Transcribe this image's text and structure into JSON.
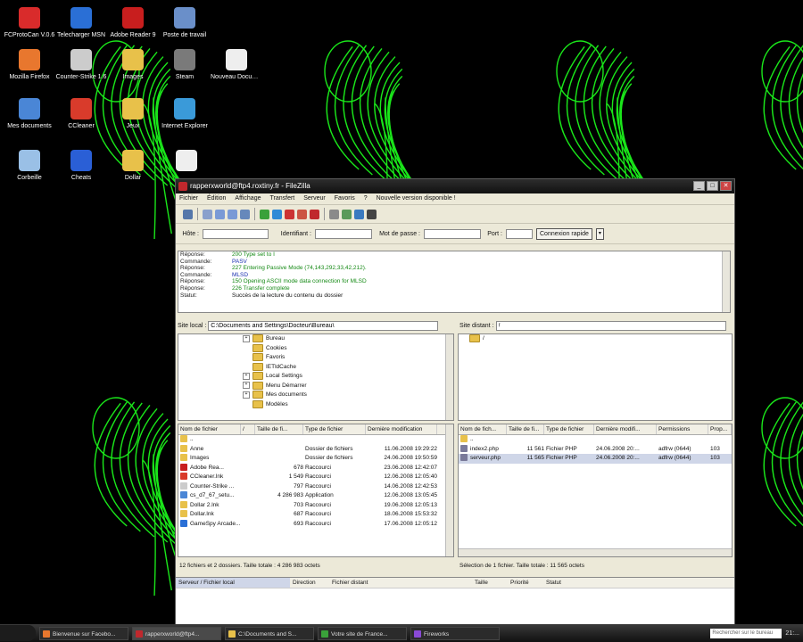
{
  "desktop": {
    "icons": [
      {
        "label": "FCProtoCan V.0.6",
        "color": "#d92b2b",
        "icon": "app-icon"
      },
      {
        "label": "Telecharger MSN",
        "color": "#2a6fd6",
        "icon": "messenger-icon"
      },
      {
        "label": "Adobe Reader 9",
        "color": "#c81e1e",
        "icon": "pdf-reader-icon"
      },
      {
        "label": "Poste de travail",
        "color": "#6a8fc9",
        "icon": "computer-icon"
      },
      {
        "label": "Mozilla Firefox",
        "color": "#e8772e",
        "icon": "firefox-icon"
      },
      {
        "label": "Counter-Strike 1.6",
        "color": "#cccccc",
        "icon": "game-icon"
      },
      {
        "label": "Images",
        "color": "#e8c14a",
        "icon": "folder-icon"
      },
      {
        "label": "Steam",
        "color": "#7a7a7a",
        "icon": "steam-icon"
      },
      {
        "label": "Nouveau Document texte",
        "color": "#eeeeee",
        "icon": "text-file-icon"
      },
      {
        "label": "Mes documents",
        "color": "#4a86d6",
        "icon": "documents-icon"
      },
      {
        "label": "CCleaner",
        "color": "#d93b2b",
        "icon": "ccleaner-icon"
      },
      {
        "label": "Jeux",
        "color": "#e8c14a",
        "icon": "folder-icon"
      },
      {
        "label": "Internet Explorer",
        "color": "#3a9ad9",
        "icon": "ie-icon"
      },
      {
        "label": "Corbeille",
        "color": "#9ac0e6",
        "icon": "recycle-bin-icon"
      },
      {
        "label": "Cheats",
        "color": "#2a5fd6",
        "icon": "cheats-icon"
      },
      {
        "label": "Dollar",
        "color": "#e8c14a",
        "icon": "dollar-icon"
      },
      {
        "label": "",
        "color": "#eeeeee",
        "icon": "document-icon"
      }
    ]
  },
  "window": {
    "title": "rapperxworld@ftp4.roxtiny.fr - FileZilla",
    "min": "_",
    "max": "□",
    "close": "✕",
    "menu": [
      "Fichier",
      "Édition",
      "Affichage",
      "Transfert",
      "Serveur",
      "Favoris",
      "?",
      "Nouvelle version disponible !"
    ],
    "toolbar_icons": [
      "site-manager-icon",
      "toggle-log-icon",
      "toggle-tree-local-icon",
      "toggle-tree-remote-icon",
      "toggle-queue-icon",
      "refresh-icon",
      "process-queue-icon",
      "cancel-icon",
      "disconnect-icon",
      "reconnect-icon",
      "directory-listing-icon",
      "filter-icon",
      "sync-browse-icon",
      "search-icon"
    ],
    "quickconnect": {
      "host_label": "Hôte :",
      "user_label": "Identifiant :",
      "pass_label": "Mot de passe :",
      "port_label": "Port :",
      "connect_button": "Connexion rapide",
      "dropdown": "▾"
    },
    "log": [
      {
        "k": "Réponse:",
        "v": "200 Type set to I",
        "c": "green"
      },
      {
        "k": "Commande:",
        "v": "PASV",
        "c": "blue"
      },
      {
        "k": "Réponse:",
        "v": "227 Entering Passive Mode (74,143,292,33,42,212).",
        "c": "green"
      },
      {
        "k": "Commande:",
        "v": "MLSD",
        "c": "blue"
      },
      {
        "k": "Réponse:",
        "v": "150 Opening ASCII mode data connection for MLSD",
        "c": "green"
      },
      {
        "k": "Réponse:",
        "v": "226 Transfer complete",
        "c": "green"
      },
      {
        "k": "Statut:",
        "v": "Succès de la lecture du contenu du dossier",
        "c": "black"
      }
    ],
    "local": {
      "label": "Site local :",
      "path": "C:\\Documents and Settings\\Docteur\\Bureau\\",
      "tree": [
        {
          "name": "Bureau",
          "exp": "+"
        },
        {
          "name": "Cookies",
          "exp": ""
        },
        {
          "name": "Favoris",
          "exp": ""
        },
        {
          "name": "IETldCache",
          "exp": ""
        },
        {
          "name": "Local Settings",
          "exp": "+"
        },
        {
          "name": "Menu Démarrer",
          "exp": "+"
        },
        {
          "name": "Mes documents",
          "exp": "+"
        },
        {
          "name": "Modèles",
          "exp": ""
        }
      ],
      "headers": [
        "Nom de fichier",
        "/",
        "Taille de fi...",
        "Type de fichier",
        "Dernière modification"
      ],
      "files": [
        {
          "name": "..",
          "size": "",
          "type": "",
          "date": "",
          "icon": "#e8c14a"
        },
        {
          "name": "Anne",
          "size": "",
          "type": "Dossier de fichiers",
          "date": "11.06.2008 19:29:22",
          "icon": "#e8c14a"
        },
        {
          "name": "Images",
          "size": "",
          "type": "Dossier de fichiers",
          "date": "24.06.2008 19:50:59",
          "icon": "#e8c14a"
        },
        {
          "name": "Adobe Rea...",
          "size": "678",
          "type": "Raccourci",
          "date": "23.06.2008 12:42:07",
          "icon": "#c81e1e"
        },
        {
          "name": "CCleaner.lnk",
          "size": "1 549",
          "type": "Raccourci",
          "date": "12.06.2008 12:05:40",
          "icon": "#d93b2b"
        },
        {
          "name": "Counter-Strike ...",
          "size": "797",
          "type": "Raccourci",
          "date": "14.06.2008 12:42:53",
          "icon": "#cccccc"
        },
        {
          "name": "cs_d7_67_setu...",
          "size": "4 286 983",
          "type": "Application",
          "date": "12.06.2008 13:05:45",
          "icon": "#4a86d6"
        },
        {
          "name": "Dollar 2.lnk",
          "size": "703",
          "type": "Raccourci",
          "date": "19.06.2008 12:05:13",
          "icon": "#e8c14a"
        },
        {
          "name": "Dollar.lnk",
          "size": "687",
          "type": "Raccourci",
          "date": "18.06.2008 15:53:32",
          "icon": "#e8c14a"
        },
        {
          "name": "GameSpy Arcade...",
          "size": "693",
          "type": "Raccourci",
          "date": "17.06.2008 12:05:12",
          "icon": "#2a6fd6"
        }
      ],
      "status": "12 fichiers et 2 dossiers. Taille totale : 4 286 983 octets"
    },
    "remote": {
      "label": "Site distant :",
      "path": "/",
      "tree": [
        {
          "name": "/"
        }
      ],
      "headers": [
        "Nom de fich...",
        "Taille de fi...",
        "Type de fichier",
        "Dernière modifi...",
        "Permissions",
        "Prop..."
      ],
      "files": [
        {
          "name": "..",
          "size": "",
          "type": "",
          "date": "",
          "perm": "",
          "owner": "",
          "sel": false
        },
        {
          "name": "index2.php",
          "size": "11 561",
          "type": "Fichier PHP",
          "date": "24.06.2008 20:...",
          "perm": "adfrw (0644)",
          "owner": "103",
          "sel": false
        },
        {
          "name": "serveur.php",
          "size": "11 565",
          "type": "Fichier PHP",
          "date": "24.06.2008 20:...",
          "perm": "adfrw (0644)",
          "owner": "103",
          "sel": true
        }
      ],
      "status": "Sélection de 1 fichier. Taille totale : 11 565 octets"
    },
    "queue": {
      "headers": [
        "Serveur / Fichier local",
        "Direction",
        "Fichier distant",
        "Taille",
        "Priorité",
        "Statut"
      ]
    }
  },
  "taskbar": {
    "tasks": [
      {
        "label": "Bienvenue sur Facebo...",
        "color": "#e8772e",
        "active": false
      },
      {
        "label": "rapperxworld@ftp4...",
        "color": "#c0282d",
        "active": true
      },
      {
        "label": "C:\\Documents and S...",
        "color": "#e8c14a",
        "active": false
      },
      {
        "label": "Votre site de France...",
        "color": "#3aa13a",
        "active": false
      },
      {
        "label": "Fireworks",
        "color": "#8a4ad6",
        "active": false
      }
    ],
    "search_placeholder": "Rechercher sur le bureau",
    "clock": "21:..."
  }
}
